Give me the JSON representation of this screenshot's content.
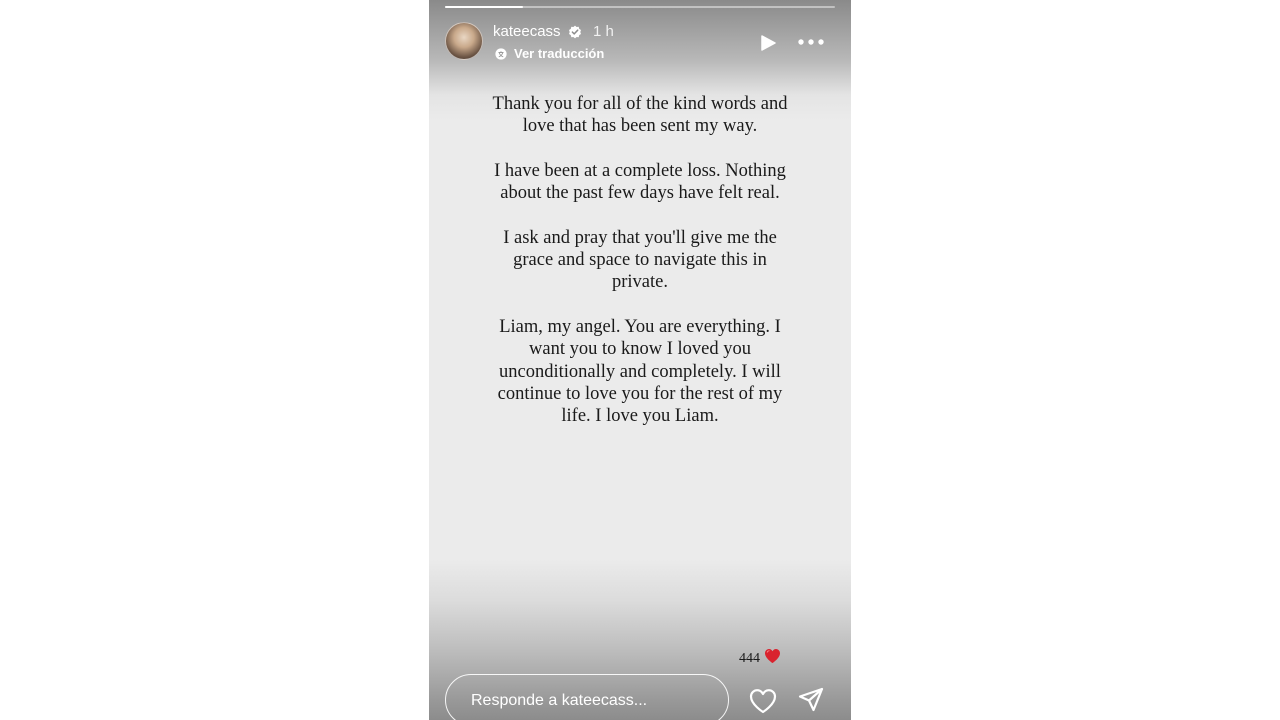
{
  "header": {
    "username": "kateecass",
    "time": "1 h",
    "translate_label": "Ver traducción",
    "progress": 0.2
  },
  "story": {
    "paragraphs": [
      "Thank you for all of the kind words and love that has been sent my way.",
      "I have been at a complete loss. Nothing about the past few days have felt real.",
      "I ask and pray that you'll give me the grace and space to navigate this in private.",
      "Liam, my angel. You are everything. I want you to know I loved you unconditionally and completely. I will continue to love you for the rest of my life. I love you Liam."
    ],
    "reaction_count": "444",
    "reaction_icon": "red-heart-icon"
  },
  "footer": {
    "reply_placeholder": "Responde a kateecass..."
  },
  "icons": {
    "verified": "verified-badge-icon",
    "translate": "translate-icon",
    "play": "play-icon",
    "more": "more-options-icon",
    "like": "heart-icon",
    "share": "send-icon"
  },
  "colors": {
    "heart": "#d9232e",
    "verified": "#ffffff"
  }
}
